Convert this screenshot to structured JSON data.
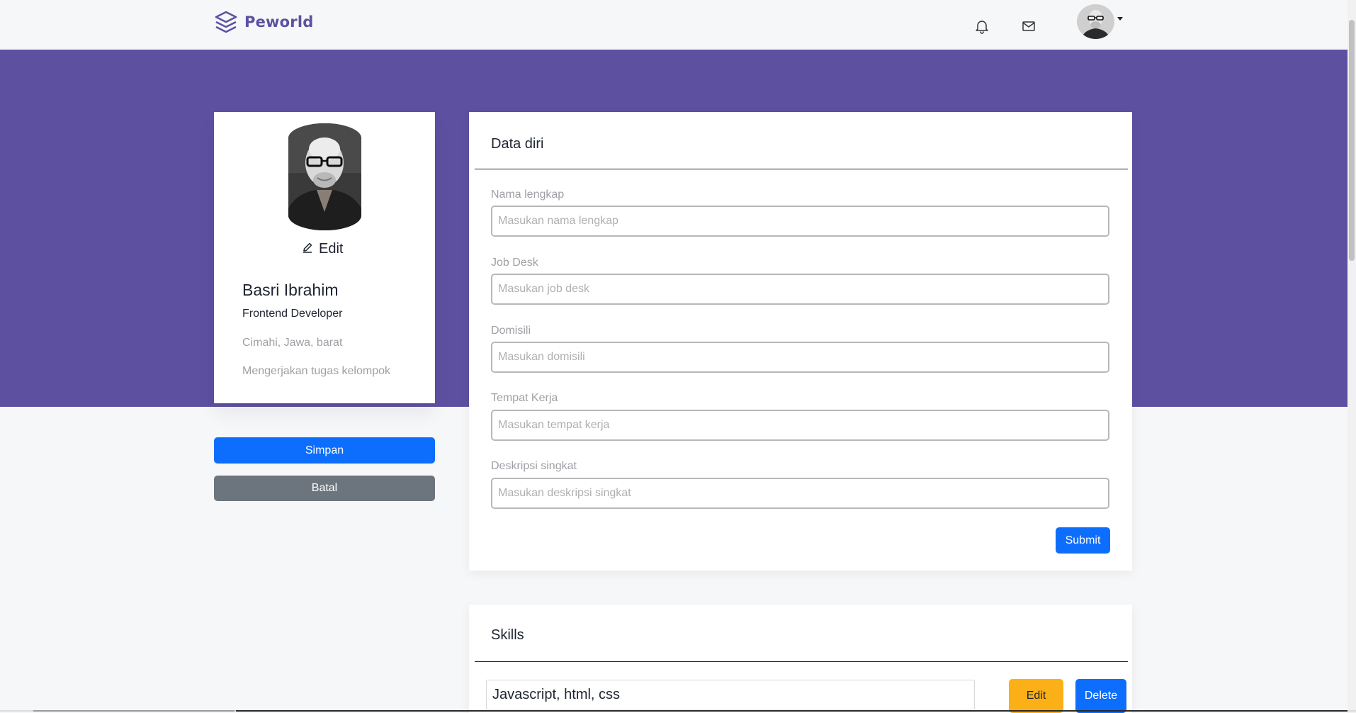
{
  "navbar": {
    "brand_name": "Peworld",
    "icons": {
      "notification": "bell-icon",
      "mail": "mail-icon",
      "logo": "layers-icon"
    }
  },
  "profile": {
    "edit_label": "Edit",
    "name": "Basri Ibrahim",
    "job": "Frontend Developer",
    "location": "Cimahi, Jawa, barat",
    "description": "Mengerjakan tugas kelompok"
  },
  "actions": {
    "save_label": "Simpan",
    "cancel_label": "Batal"
  },
  "data_diri": {
    "title": "Data diri",
    "fields": [
      {
        "label": "Nama lengkap",
        "placeholder": "Masukan nama lengkap",
        "value": ""
      },
      {
        "label": "Job Desk",
        "placeholder": "Masukan job desk",
        "value": ""
      },
      {
        "label": "Domisili",
        "placeholder": "Masukan domisili",
        "value": ""
      },
      {
        "label": "Tempat Kerja",
        "placeholder": "Masukan tempat kerja",
        "value": ""
      },
      {
        "label": "Deskripsi singkat",
        "placeholder": "Masukan deskripsi singkat",
        "value": ""
      }
    ],
    "submit_label": "Submit"
  },
  "skills": {
    "title": "Skills",
    "value": "Javascript, html, css",
    "edit_label": "Edit",
    "delete_label": "Delete"
  },
  "colors": {
    "brand": "#5e50a1",
    "primary": "#0d6efd",
    "secondary": "#6c757d",
    "warning": "#fbb017"
  }
}
